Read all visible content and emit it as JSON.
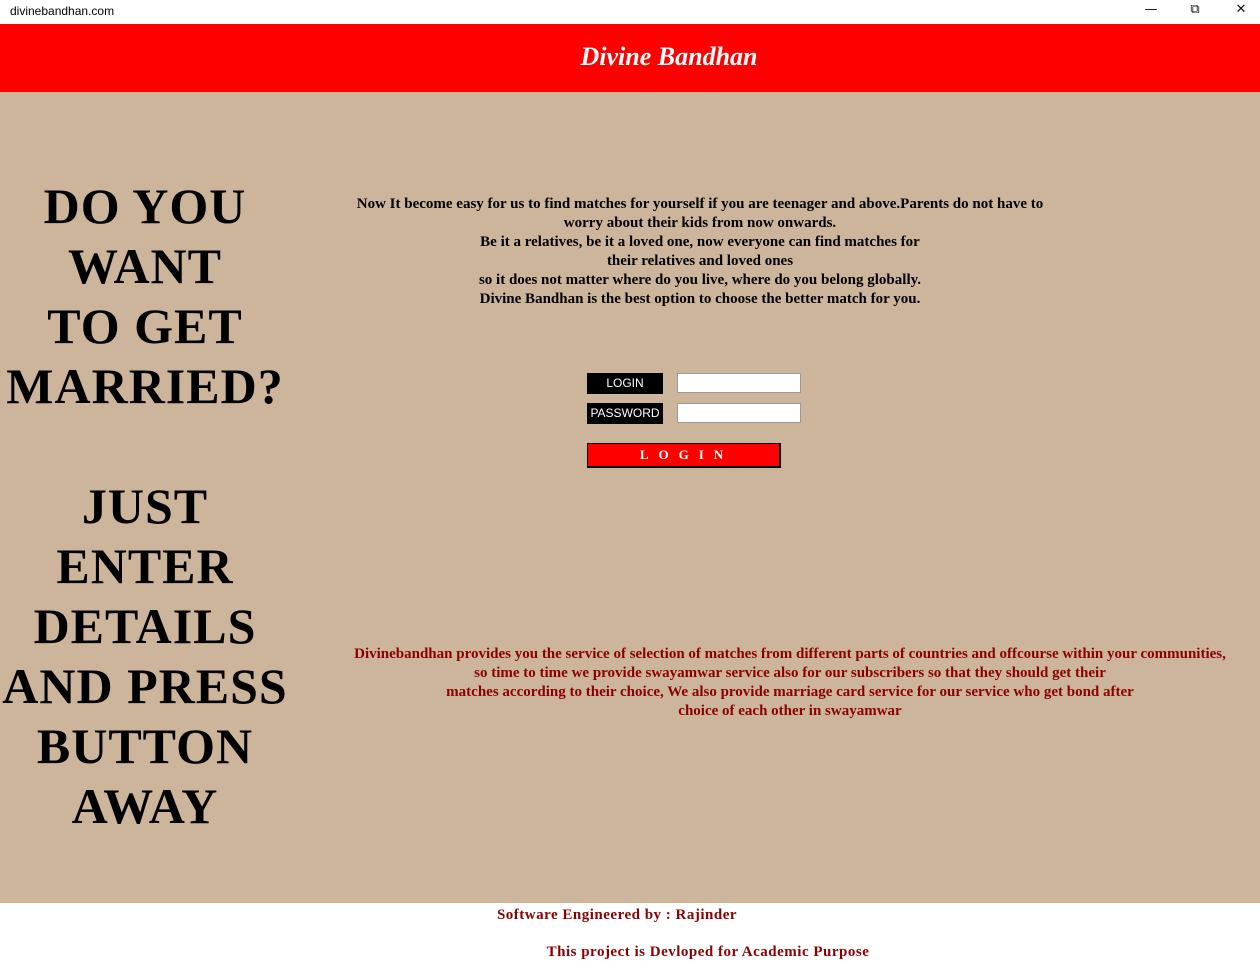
{
  "window": {
    "title": "divinebandhan.com",
    "minimize_icon": "minimize-icon",
    "restore_icon": "restore-icon",
    "close_icon": "close-icon"
  },
  "header": {
    "title": "Divine Bandhan",
    "background": "#ff0000"
  },
  "promo": {
    "lines_top": [
      "DO YOU",
      "WANT",
      "TO GET",
      "MARRIED?"
    ],
    "lines_bottom": [
      "JUST",
      "ENTER",
      "DETAILS",
      "AND PRESS",
      "BUTTON",
      "AWAY"
    ]
  },
  "intro": {
    "lines": [
      "Now It become easy for us to find matches for yourself if you are teenager and above.Parents do not have to",
      "worry about their kids from now onwards.",
      "Be it a relatives, be it a loved one, now everyone can find matches for",
      "their relatives and  loved ones",
      " so it does not matter where do you live, where do you belong globally.",
      "Divine Bandhan is the best option to choose the better match for you."
    ]
  },
  "login_form": {
    "login_label": "LOGIN",
    "password_label": "PASSWORD",
    "login_value": "",
    "password_value": "",
    "submit_label": "LOGIN"
  },
  "service": {
    "lines": [
      "Divinebandhan provides you the service of selection of matches from different parts of countries and offcourse within your communities,",
      "so time to time we provide swayamwar service also for our subscribers so that they should get their",
      "matches according to their choice, We also provide marriage card service for our service who get bond after",
      "choice of each other in swayamwar"
    ]
  },
  "footer": {
    "credit": "Software Engineered by : Rajinder",
    "note": "This project is Devloped for Academic Purpose"
  },
  "colors": {
    "page_background": "#cdb59c",
    "accent": "#ff0000",
    "service_text": "#8b0000"
  }
}
